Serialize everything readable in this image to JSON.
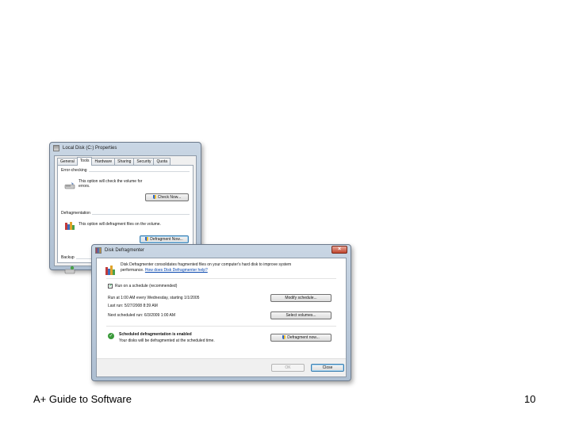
{
  "properties_window": {
    "title": "Local Disk (C:) Properties",
    "tabs": [
      "General",
      "Tools",
      "Hardware",
      "Sharing",
      "Security",
      "Quota"
    ],
    "active_tab": "Tools",
    "error_checking": {
      "label": "Error-checking",
      "text_line1": "This option will check the volume for",
      "text_line2": "errors.",
      "button": "Check Now..."
    },
    "defragmentation": {
      "label": "Defragmentation",
      "text": "This option will defragment files on the volume.",
      "button": "Defragment Now..."
    },
    "backup": {
      "label": "Backup"
    }
  },
  "defrag_window": {
    "title": "Disk Defragmenter",
    "intro_line1": "Disk Defragmenter consolidates fragmented files on your computer's hard disk to improve system",
    "intro_line2_prefix": "performance.",
    "help_link": "How does Disk Defragmenter help?",
    "schedule_checkbox_label": "Run on a schedule (recommended)",
    "schedule_checked": true,
    "run_at": "Run at 1:00 AM every Wednesday, starting 1/1/2005",
    "last_run": "Last run: 5/27/2008 8:39 AM",
    "next_run": "Next scheduled run: 6/3/2009 1:00 AM",
    "modify_button": "Modify schedule...",
    "select_button": "Select volumes...",
    "status_title": "Scheduled defragmentation is enabled",
    "status_text": "Your disks will be defragmented at the scheduled time.",
    "defrag_now_button": "Defragment now...",
    "ok_button": "OK",
    "close_button": "Close"
  },
  "slide": {
    "footer_text": "A+ Guide to Software",
    "page_number": "10"
  }
}
